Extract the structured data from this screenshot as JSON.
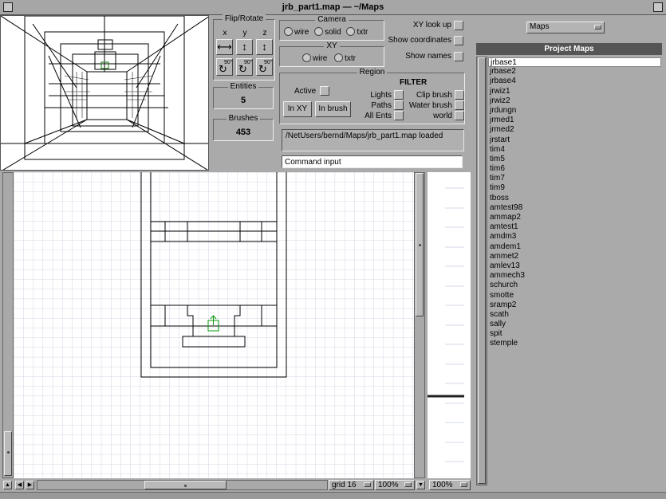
{
  "window": {
    "title": "jrb_part1.map — ~/Maps"
  },
  "flip": {
    "title": "Flip/Rotate",
    "x": "x",
    "y": "y",
    "z": "z",
    "rot": "90°"
  },
  "entities": {
    "label": "Entities",
    "value": "5"
  },
  "brushes": {
    "label": "Brushes",
    "value": "453"
  },
  "camera": {
    "title": "Camera",
    "wire": "wire",
    "solid": "solid",
    "txtr": "txtr"
  },
  "xyopt": {
    "title": "XY",
    "wire": "wire",
    "txtr": "txtr"
  },
  "toggles": {
    "xy_look_up": "XY look up",
    "show_coordinates": "Show coordinates",
    "show_names": "Show names"
  },
  "region": {
    "title": "Region",
    "active": "Active",
    "in_xy": "In XY",
    "in_brush": "In brush"
  },
  "filter": {
    "title": "FILTER",
    "lights": "Lights",
    "paths": "Paths",
    "all_ents": "All Ents",
    "clip_brush": "Clip brush",
    "water_brush": "Water brush",
    "world": "world"
  },
  "status": {
    "message": "/NetUsers/bernd/Maps/jrb_part1.map loaded"
  },
  "command": {
    "value": "Command input"
  },
  "maps_popup": {
    "value": "Maps"
  },
  "project_maps": {
    "title": "Project Maps",
    "items": [
      "jrbase1",
      "jrbase2",
      "jrbase4",
      "jrwiz1",
      "jrwiz2",
      "jrdungn",
      "jrmed1",
      "jrmed2",
      "jrstart",
      "tim4",
      "tim5",
      "tim6",
      "tim7",
      "tim9",
      "tboss",
      "amtest98",
      "ammap2",
      "amtest1",
      "amdm3",
      "amdem1",
      "ammet2",
      "amlev13",
      "ammech3",
      "schurch",
      "smotte",
      "sramp2",
      "scath",
      "sally",
      "spit",
      "stemple"
    ],
    "selected_index": 0
  },
  "xy_footer": {
    "grid": "grid 16",
    "zoom": "100%"
  },
  "z_footer": {
    "zoom": "100%"
  }
}
